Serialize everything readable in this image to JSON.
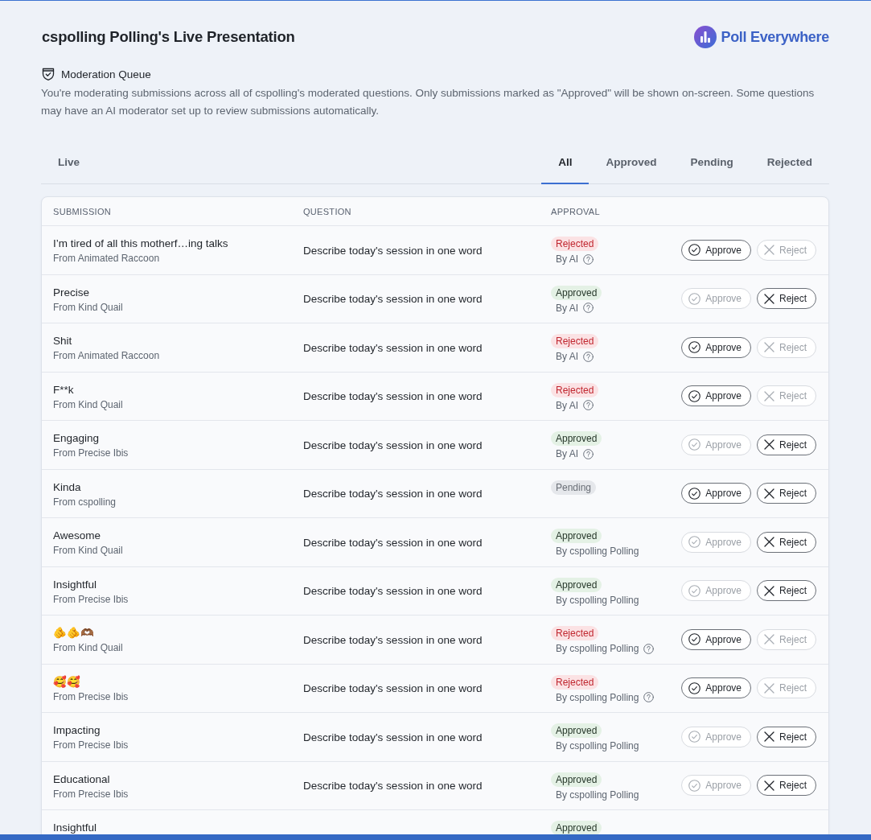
{
  "header": {
    "title": "cspolling Polling's Live Presentation",
    "logo_text": "Poll Everywhere"
  },
  "queue": {
    "heading": "Moderation Queue",
    "description": "You're moderating submissions across all of cspolling's moderated questions. Only submissions marked as \"Approved\" will be shown on-screen. Some questions may have an AI moderator set up to review submissions automatically."
  },
  "view_tab": {
    "label": "Live",
    "selected": false
  },
  "filter_tabs": [
    {
      "label": "All",
      "selected": true
    },
    {
      "label": "Approved",
      "selected": false
    },
    {
      "label": "Pending",
      "selected": false
    },
    {
      "label": "Rejected",
      "selected": false
    }
  ],
  "table": {
    "columns": [
      "SUBMISSION",
      "QUESTION",
      "APPROVAL"
    ],
    "rows": [
      {
        "submission": "I’m tired of all this motherf…ing talks",
        "author": "From Animated Raccoon",
        "question": "Describe today's session in one word",
        "status": {
          "kind": "rejected",
          "label": "Rejected"
        },
        "moderator": {
          "text": "By AI",
          "help": true
        },
        "buttons": [
          {
            "kind": "approve",
            "label": "Approve",
            "disabled": false
          },
          {
            "kind": "reject",
            "label": "Reject",
            "disabled": true
          }
        ]
      },
      {
        "submission": "Precise",
        "author": "From Kind Quail",
        "question": "Describe today's session in one word",
        "status": {
          "kind": "approved",
          "label": "Approved"
        },
        "moderator": {
          "text": "By AI",
          "help": true
        },
        "buttons": [
          {
            "kind": "approve",
            "label": "Approve",
            "disabled": true
          },
          {
            "kind": "reject",
            "label": "Reject",
            "disabled": false
          }
        ]
      },
      {
        "submission": "Shit",
        "author": "From Animated Raccoon",
        "question": "Describe today's session in one word",
        "status": {
          "kind": "rejected",
          "label": "Rejected"
        },
        "moderator": {
          "text": "By AI",
          "help": true
        },
        "buttons": [
          {
            "kind": "approve",
            "label": "Approve",
            "disabled": false
          },
          {
            "kind": "reject",
            "label": "Reject",
            "disabled": true
          }
        ]
      },
      {
        "submission": "F**k",
        "author": "From Kind Quail",
        "question": "Describe today's session in one word",
        "status": {
          "kind": "rejected",
          "label": "Rejected"
        },
        "moderator": {
          "text": "By AI",
          "help": true
        },
        "buttons": [
          {
            "kind": "approve",
            "label": "Approve",
            "disabled": false
          },
          {
            "kind": "reject",
            "label": "Reject",
            "disabled": true
          }
        ]
      },
      {
        "submission": "Engaging",
        "author": "From Precise Ibis",
        "question": "Describe today's session in one word",
        "status": {
          "kind": "approved",
          "label": "Approved"
        },
        "moderator": {
          "text": "By AI",
          "help": true
        },
        "buttons": [
          {
            "kind": "approve",
            "label": "Approve",
            "disabled": true
          },
          {
            "kind": "reject",
            "label": "Reject",
            "disabled": false
          }
        ]
      },
      {
        "submission": "Kinda",
        "author": "From cspolling",
        "question": "Describe today's session in one word",
        "status": {
          "kind": "pending",
          "label": "Pending"
        },
        "buttons": [
          {
            "kind": "approve",
            "label": "Approve",
            "disabled": false
          },
          {
            "kind": "reject",
            "label": "Reject",
            "disabled": false
          }
        ]
      },
      {
        "submission": "Awesome",
        "author": "From Kind Quail",
        "question": "Describe today's session in one word",
        "status": {
          "kind": "approved",
          "label": "Approved"
        },
        "moderator": {
          "text": "By cspolling Polling",
          "help": false
        },
        "buttons": [
          {
            "kind": "approve",
            "label": "Approve",
            "disabled": true
          },
          {
            "kind": "reject",
            "label": "Reject",
            "disabled": false
          }
        ]
      },
      {
        "submission": "Insightful",
        "author": "From Precise Ibis",
        "question": "Describe today's session in one word",
        "status": {
          "kind": "approved",
          "label": "Approved"
        },
        "moderator": {
          "text": "By cspolling Polling",
          "help": false
        },
        "buttons": [
          {
            "kind": "approve",
            "label": "Approve",
            "disabled": true
          },
          {
            "kind": "reject",
            "label": "Reject",
            "disabled": false
          }
        ]
      },
      {
        "submission": "🫵🫵🫶🏾",
        "author": "From Kind Quail",
        "question": "Describe today's session in one word",
        "status": {
          "kind": "rejected",
          "label": "Rejected"
        },
        "moderator": {
          "text": "By cspolling Polling",
          "help": true
        },
        "buttons": [
          {
            "kind": "approve",
            "label": "Approve",
            "disabled": false
          },
          {
            "kind": "reject",
            "label": "Reject",
            "disabled": true
          }
        ]
      },
      {
        "submission": "🥰🥰",
        "author": "From Precise Ibis",
        "question": "Describe today's session in one word",
        "status": {
          "kind": "rejected",
          "label": "Rejected"
        },
        "moderator": {
          "text": "By cspolling Polling",
          "help": true
        },
        "buttons": [
          {
            "kind": "approve",
            "label": "Approve",
            "disabled": false
          },
          {
            "kind": "reject",
            "label": "Reject",
            "disabled": true
          }
        ]
      },
      {
        "submission": "Impacting",
        "author": "From Precise Ibis",
        "question": "Describe today's session in one word",
        "status": {
          "kind": "approved",
          "label": "Approved"
        },
        "moderator": {
          "text": "By cspolling Polling",
          "help": false
        },
        "buttons": [
          {
            "kind": "approve",
            "label": "Approve",
            "disabled": true
          },
          {
            "kind": "reject",
            "label": "Reject",
            "disabled": false
          }
        ]
      },
      {
        "submission": "Educational",
        "author": "From Precise Ibis",
        "question": "Describe today's session in one word",
        "status": {
          "kind": "approved",
          "label": "Approved"
        },
        "moderator": {
          "text": "By cspolling Polling",
          "help": false
        },
        "buttons": [
          {
            "kind": "approve",
            "label": "Approve",
            "disabled": true
          },
          {
            "kind": "reject",
            "label": "Reject",
            "disabled": false
          }
        ]
      },
      {
        "submission": "Insightful",
        "status": {
          "kind": "approved",
          "label": "Approved"
        }
      }
    ]
  }
}
